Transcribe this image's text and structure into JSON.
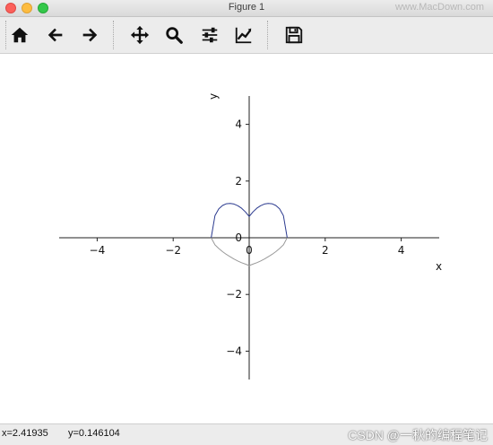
{
  "window": {
    "title": "Figure 1"
  },
  "watermarks": {
    "top_right": "www.MacDown.com",
    "bottom_right": "CSDN @一秋的编程笔记"
  },
  "toolbar": {
    "buttons": [
      {
        "name": "home-button",
        "icon": "home-icon"
      },
      {
        "name": "back-button",
        "icon": "arrow-left-icon"
      },
      {
        "name": "forward-button",
        "icon": "arrow-right-icon"
      },
      {
        "name": "pan-button",
        "icon": "move-icon"
      },
      {
        "name": "zoom-button",
        "icon": "magnifier-icon"
      },
      {
        "name": "configure-subplots-button",
        "icon": "sliders-icon"
      },
      {
        "name": "edit-axis-button",
        "icon": "line-chart-icon"
      },
      {
        "name": "save-button",
        "icon": "floppy-disk-icon"
      }
    ]
  },
  "status": {
    "x_readout": "x=2.41935",
    "y_readout": "y=0.146104"
  },
  "chart_data": {
    "type": "line",
    "title": "",
    "xlabel": "x",
    "ylabel": "y",
    "xlim": [
      -5,
      5
    ],
    "ylim": [
      -5,
      5
    ],
    "x_ticks": [
      -4,
      -2,
      0,
      2,
      4
    ],
    "y_ticks": [
      -4,
      -2,
      0,
      2,
      4
    ],
    "x_tick_labels": [
      "−4",
      "−2",
      "0",
      "2",
      "4"
    ],
    "y_tick_labels": [
      "−4",
      "−2",
      "0",
      "2",
      "4"
    ],
    "spines": "centered at origin",
    "grid": false,
    "series": [
      {
        "color": "#2b3a8f",
        "x": [
          -1.0,
          -0.9,
          -0.8,
          -0.7,
          -0.6,
          -0.5,
          -0.4,
          -0.3,
          -0.2,
          -0.1,
          0.0,
          0.1,
          0.2,
          0.3,
          0.4,
          0.5,
          0.6,
          0.7,
          0.8,
          0.9,
          1.0
        ],
        "y": [
          0.0,
          0.78,
          1.02,
          1.14,
          1.2,
          1.21,
          1.19,
          1.13,
          1.04,
          0.91,
          0.75,
          0.91,
          1.04,
          1.13,
          1.19,
          1.21,
          1.2,
          1.14,
          1.02,
          0.78,
          0.0
        ]
      },
      {
        "color": "#9a9a9a",
        "x": [
          -1.0,
          -0.9,
          -0.8,
          -0.7,
          -0.6,
          -0.5,
          -0.4,
          -0.3,
          -0.2,
          -0.1,
          0.0,
          0.1,
          0.2,
          0.3,
          0.4,
          0.5,
          0.6,
          0.7,
          0.8,
          0.9,
          1.0
        ],
        "y": [
          0.0,
          -0.25,
          -0.38,
          -0.49,
          -0.59,
          -0.67,
          -0.75,
          -0.82,
          -0.88,
          -0.93,
          -0.98,
          -0.93,
          -0.88,
          -0.82,
          -0.75,
          -0.67,
          -0.59,
          -0.49,
          -0.38,
          -0.25,
          0.0
        ]
      }
    ]
  }
}
